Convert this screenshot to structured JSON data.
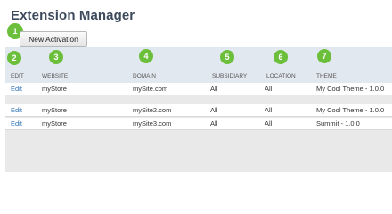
{
  "title": "Extension Manager",
  "new_button": "New Activation",
  "callouts": [
    "1",
    "2",
    "3",
    "4",
    "5",
    "6",
    "7"
  ],
  "columns": [
    "EDIT",
    "WEBSITE",
    "DOMAIN",
    "SUBSIDIARY",
    "LOCATION",
    "THEME"
  ],
  "rows": [
    {
      "edit": "Edit",
      "website": "myStore",
      "domain": "mySite.com",
      "subsidiary": "All",
      "location": "All",
      "theme": "My Cool Theme - 1.0.0"
    },
    {
      "edit": "Edit",
      "website": "myStore",
      "domain": "mySite2.com",
      "subsidiary": "All",
      "location": "All",
      "theme": "My Cool Theme - 1.0.0"
    },
    {
      "edit": "Edit",
      "website": "myStore",
      "domain": "mySite3.com",
      "subsidiary": "All",
      "location": "All",
      "theme": "Summit - 1.0.0"
    }
  ],
  "colors": {
    "callout": "#6cbf3b",
    "header_bg": "#e2e8f0",
    "link": "#2a6fb5",
    "title": "#3c4a5c"
  }
}
